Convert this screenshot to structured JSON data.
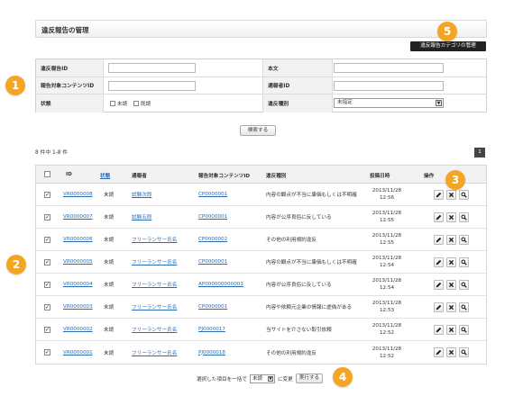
{
  "header": {
    "title": "違反報告の管理",
    "category_button": "違反報告カテゴリの管理"
  },
  "search": {
    "labels": {
      "report_id": "違反報告ID",
      "body": "本文",
      "content_id": "報告対象コンテンツID",
      "reporter_id": "通報者ID",
      "status": "状態",
      "type": "違反種別"
    },
    "status_options": [
      "未読",
      "既読"
    ],
    "type_selected": "未指定",
    "search_button": "検索する"
  },
  "results": {
    "count_text": "8 件中 1-8 件",
    "page": "1"
  },
  "table": {
    "headers": [
      "ID",
      "状態",
      "通報者",
      "報告対象コンテンツID",
      "違反種別",
      "投稿日時",
      "操作"
    ],
    "rows": [
      {
        "id": "VR0000008",
        "status": "未読",
        "reporter": "試験次郎",
        "content_id": "CP0000001",
        "type": "内容の観点が不当に康価もしくは不明確",
        "date": "2013/11/28",
        "time": "12:56"
      },
      {
        "id": "VR0000007",
        "status": "未読",
        "reporter": "試験五郎",
        "content_id": "CP0000001",
        "type": "内容が公序良俗に反している",
        "date": "2013/11/28",
        "time": "12:55"
      },
      {
        "id": "VR0000006",
        "status": "未読",
        "reporter": "フリーランサー氏名",
        "content_id": "CP0000002",
        "type": "その他の利用規約違反",
        "date": "2013/11/28",
        "time": "12:55"
      },
      {
        "id": "VR0000005",
        "status": "未読",
        "reporter": "フリーランサー氏名",
        "content_id": "CP0000001",
        "type": "内容の観点が不当に康価もしくは不明確",
        "date": "2013/11/28",
        "time": "12:54"
      },
      {
        "id": "VR0000004",
        "status": "未読",
        "reporter": "フリーランサー氏名",
        "content_id": "AP000000000003",
        "type": "内容が公序良俗に反している",
        "date": "2013/11/28",
        "time": "12:54"
      },
      {
        "id": "VR0000003",
        "status": "未読",
        "reporter": "フリーランサー氏名",
        "content_id": "CP0000001",
        "type": "内容や依頼元企業の情報に虚偽がある",
        "date": "2013/11/28",
        "time": "12:53"
      },
      {
        "id": "VR0000002",
        "status": "未読",
        "reporter": "フリーランサー氏名",
        "content_id": "PJ0000017",
        "type": "当サイトを介さない取引依頼",
        "date": "2013/11/28",
        "time": "12:52"
      },
      {
        "id": "VR0000001",
        "status": "未読",
        "reporter": "フリーランサー氏名",
        "content_id": "PJ0000018",
        "type": "その他の利用規約違反",
        "date": "2013/11/28",
        "time": "12:52"
      }
    ]
  },
  "bulk": {
    "prefix": "選択した項目を一括で",
    "selected": "未読",
    "suffix": "に変更",
    "button": "実行する"
  },
  "callouts": [
    "1",
    "2",
    "3",
    "4",
    "5"
  ],
  "colors": {
    "callout": "#f5a524",
    "link": "#2a6bb3"
  }
}
